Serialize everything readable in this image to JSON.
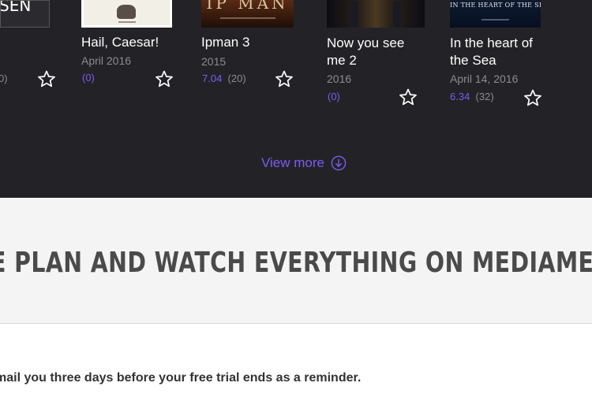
{
  "colors": {
    "background_dark": "#232327",
    "accent": "#7b5cf0",
    "muted": "#8b8b90",
    "band": "#f4f4f4"
  },
  "movies": [
    {
      "poster_text": "SEN",
      "title": "",
      "date": "",
      "rating_score": "",
      "rating_count": "0)",
      "count_accent": false
    },
    {
      "poster_text": "",
      "title": "Hail, Caesar!",
      "date": "April 2016",
      "rating_score": "",
      "rating_count": "(0)",
      "count_accent": true
    },
    {
      "poster_text": "IP MAN",
      "title": "Ipman 3",
      "date": "2015",
      "rating_score": "7.04",
      "rating_count": "(20)",
      "count_accent": false
    },
    {
      "poster_text": "",
      "title": "Now you see me 2",
      "date": "2016",
      "rating_score": "",
      "rating_count": "(0)",
      "count_accent": true
    },
    {
      "poster_text": "IN THE HEART OF THE SEA",
      "title": "In the heart of the Sea",
      "date": "April 14, 2016",
      "rating_score": "6.34",
      "rating_count": "(32)",
      "count_accent": false
    }
  ],
  "view_more": {
    "label": "View more",
    "icon": "arrow-down-circle-icon"
  },
  "plan_headline": "E PLAN AND WATCH EVERYTHING ON MEDIAME",
  "trial_notice": "mail you three days before your free trial ends as a reminder."
}
